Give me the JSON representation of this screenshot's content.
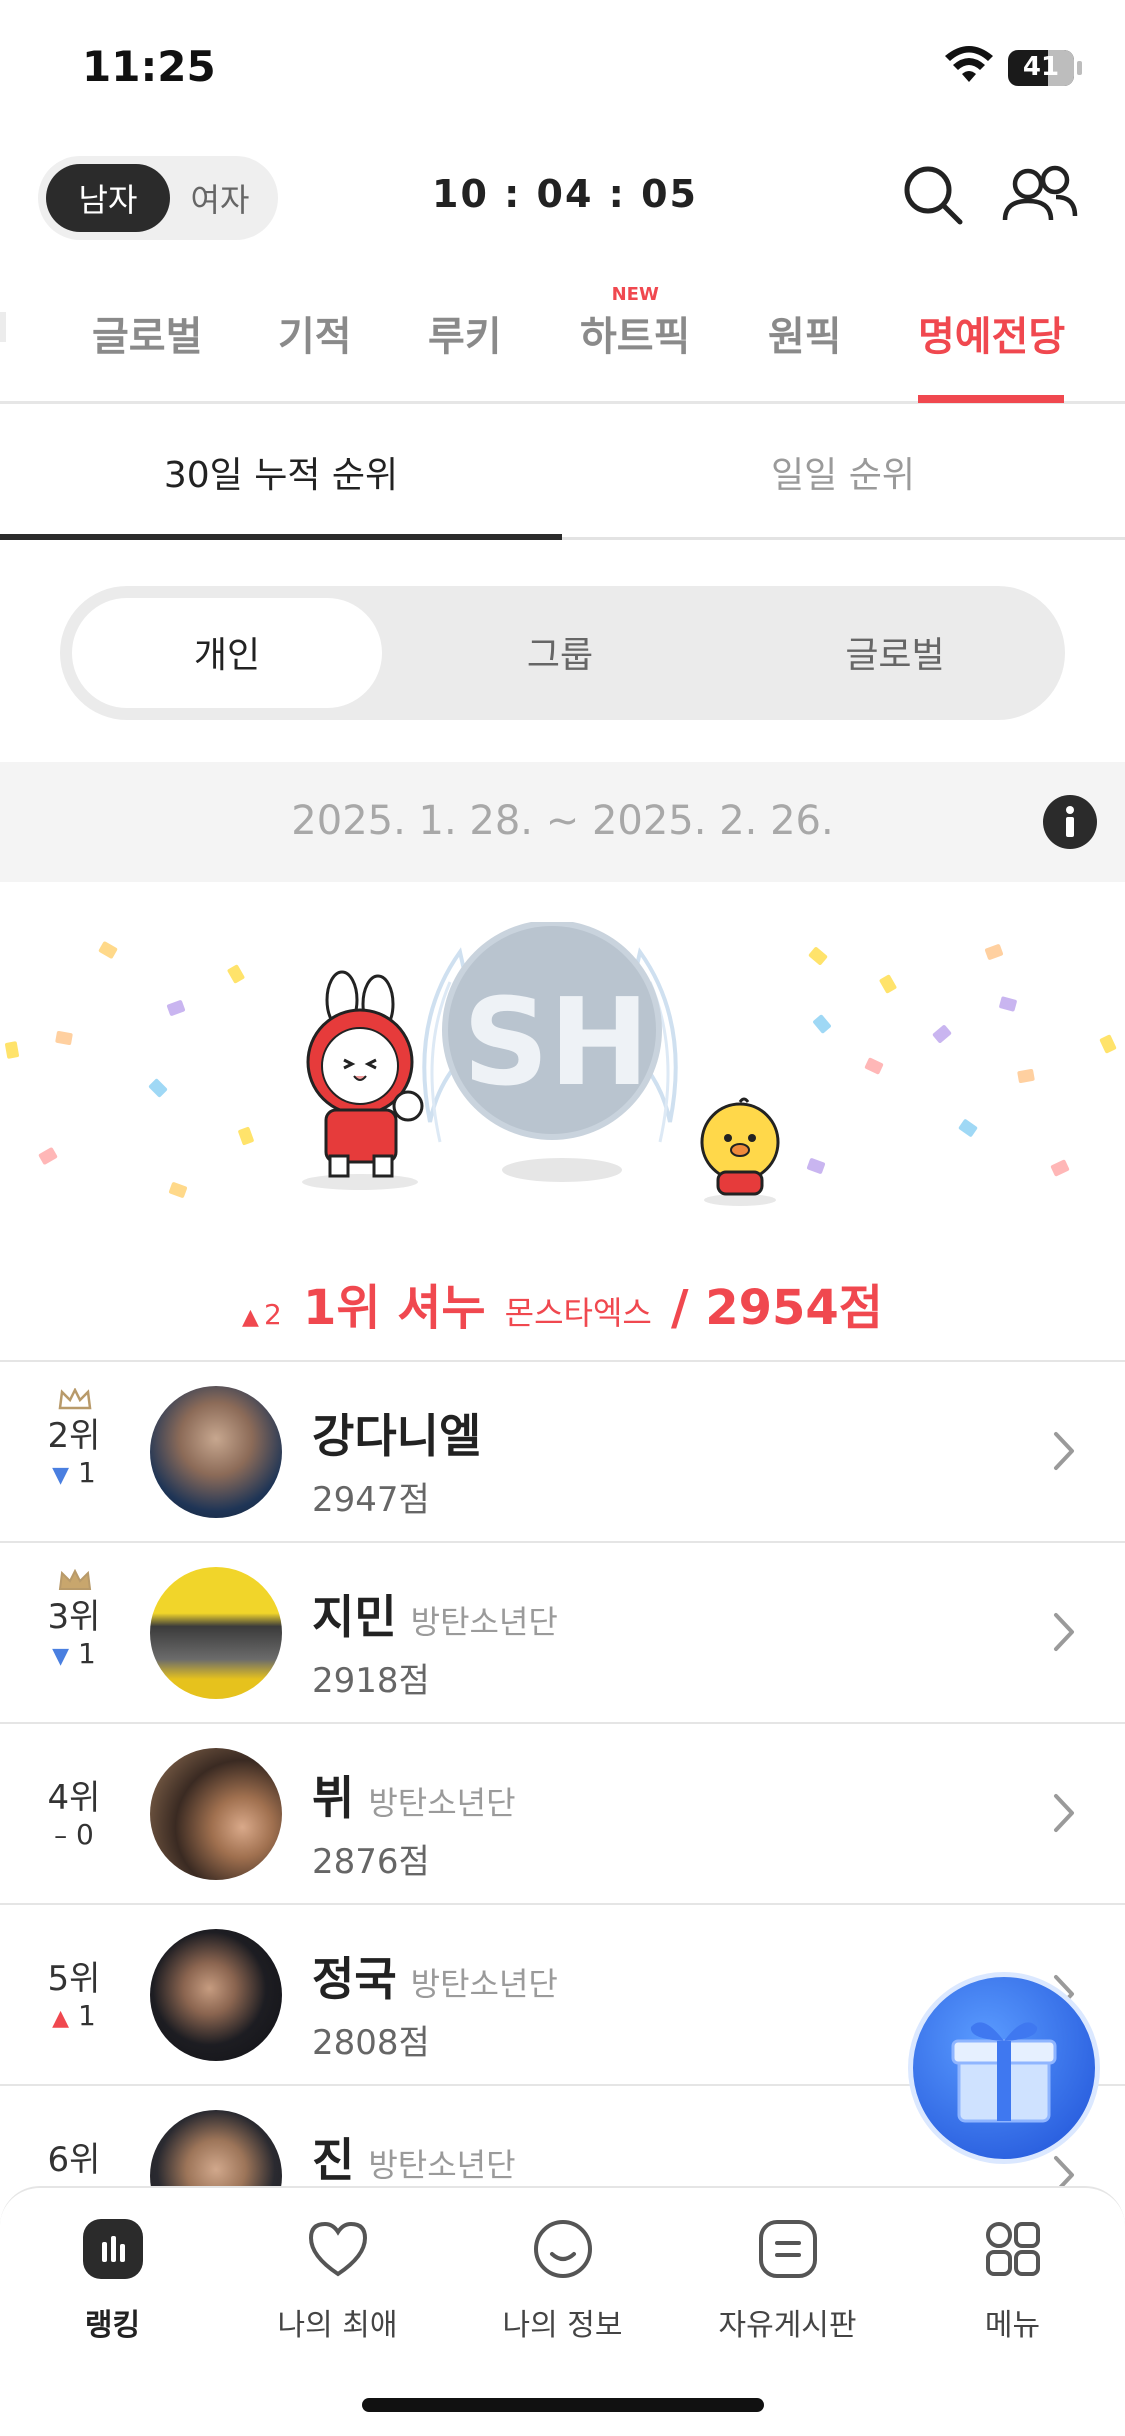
{
  "status": {
    "time": "11:25",
    "battery": "41"
  },
  "header": {
    "gender_on": "남자",
    "gender_off": "여자",
    "countdown": "10 : 04 : 05"
  },
  "categories": [
    {
      "label": "글로벌",
      "new": ""
    },
    {
      "label": "기적",
      "new": ""
    },
    {
      "label": "루키",
      "new": ""
    },
    {
      "label": "하트픽",
      "new": "NEW"
    },
    {
      "label": "원픽",
      "new": ""
    },
    {
      "label": "명예전당",
      "new": ""
    }
  ],
  "rank_tabs": [
    "30일 누적 순위",
    "일일 순위"
  ],
  "segments": [
    "개인",
    "그룹",
    "글로벌"
  ],
  "date_range": "2025. 1. 28. ~ 2025. 2. 26.",
  "winner": {
    "change": "2",
    "name": "1위 셔누",
    "group": "몬스타엑스",
    "points": "/ 2954점",
    "emblem": "SH"
  },
  "ranking": [
    {
      "rank": "2위",
      "dir": "down",
      "change": "1",
      "name": "강다니엘",
      "group": "",
      "points": "2947점",
      "crown": true
    },
    {
      "rank": "3위",
      "dir": "down",
      "change": "1",
      "name": "지민",
      "group": "방탄소년단",
      "points": "2918점",
      "crown": true
    },
    {
      "rank": "4위",
      "dir": "same",
      "change": "0",
      "name": "뷔",
      "group": "방탄소년단",
      "points": "2876점",
      "crown": false
    },
    {
      "rank": "5위",
      "dir": "up",
      "change": "1",
      "name": "정국",
      "group": "방탄소년단",
      "points": "2808점",
      "crown": false
    },
    {
      "rank": "6위",
      "dir": "",
      "change": "",
      "name": "진",
      "group": "방탄소년단",
      "points": "",
      "crown": false
    }
  ],
  "nav": [
    {
      "label": "랭킹",
      "icon": "chart-icon"
    },
    {
      "label": "나의 최애",
      "icon": "heart-icon"
    },
    {
      "label": "나의 정보",
      "icon": "smile-icon"
    },
    {
      "label": "자유게시판",
      "icon": "board-icon"
    },
    {
      "label": "메뉴",
      "icon": "menu-grid-icon"
    }
  ],
  "colors": {
    "accent": "#f0484f",
    "down": "#4a7fe0",
    "dark": "#2b2b2b"
  }
}
